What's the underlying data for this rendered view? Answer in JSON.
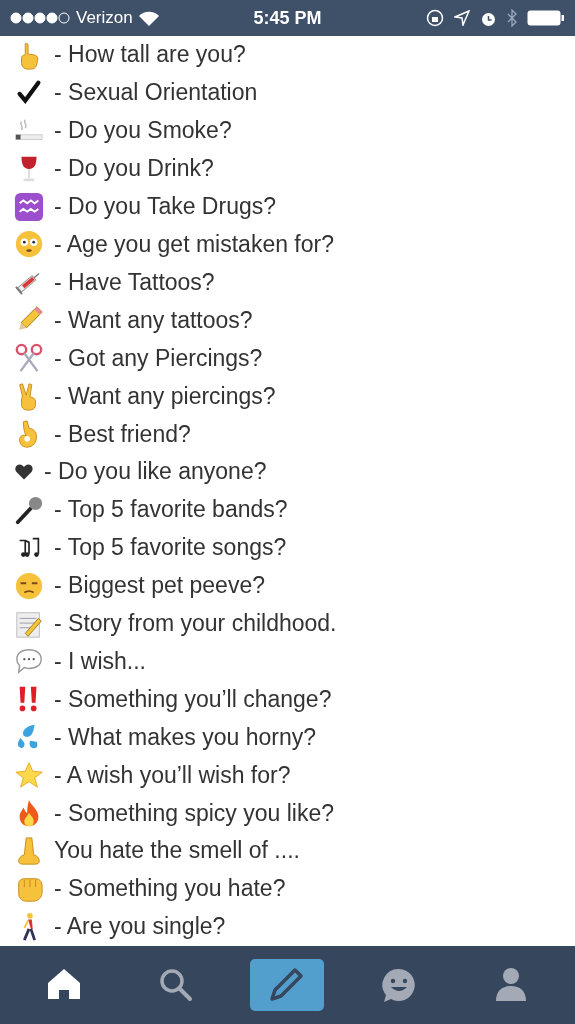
{
  "status_bar": {
    "carrier": "Verizon",
    "time": "5:45 PM"
  },
  "items": [
    {
      "text": "- How tall are you?"
    },
    {
      "text": "- Sexual Orientation"
    },
    {
      "text": "- Do you Smoke?"
    },
    {
      "text": "- Do you Drink?"
    },
    {
      "text": "- Do you Take Drugs?"
    },
    {
      "text": "- Age you get mistaken for?"
    },
    {
      "text": "- Have Tattoos?"
    },
    {
      "text": "- Want any tattoos?"
    },
    {
      "text": "- Got any Piercings?"
    },
    {
      "text": "- Want any piercings?"
    },
    {
      "text": "- Best friend?"
    },
    {
      "text": "- Do you like anyone?"
    },
    {
      "text": "- Top 5 favorite bands?"
    },
    {
      "text": "- Top 5 favorite songs?"
    },
    {
      "text": "- Biggest pet peeve?"
    },
    {
      "text": "- Story from your childhood."
    },
    {
      "text": "- I wish..."
    },
    {
      "text": "- Something you’ll change?"
    },
    {
      "text": "- What makes you horny?"
    },
    {
      "text": "- A wish you’ll wish for?"
    },
    {
      "text": "- Something spicy you like?"
    },
    {
      "text": "You hate the smell of ...."
    },
    {
      "text": "- Something you hate?"
    },
    {
      "text": "- Are you single?"
    }
  ],
  "tab_bar": [
    {
      "kind": "home",
      "selected": true
    },
    {
      "kind": "search",
      "selected": false
    },
    {
      "kind": "compose",
      "selected": false
    },
    {
      "kind": "chat",
      "selected": false
    },
    {
      "kind": "account",
      "selected": false
    }
  ]
}
